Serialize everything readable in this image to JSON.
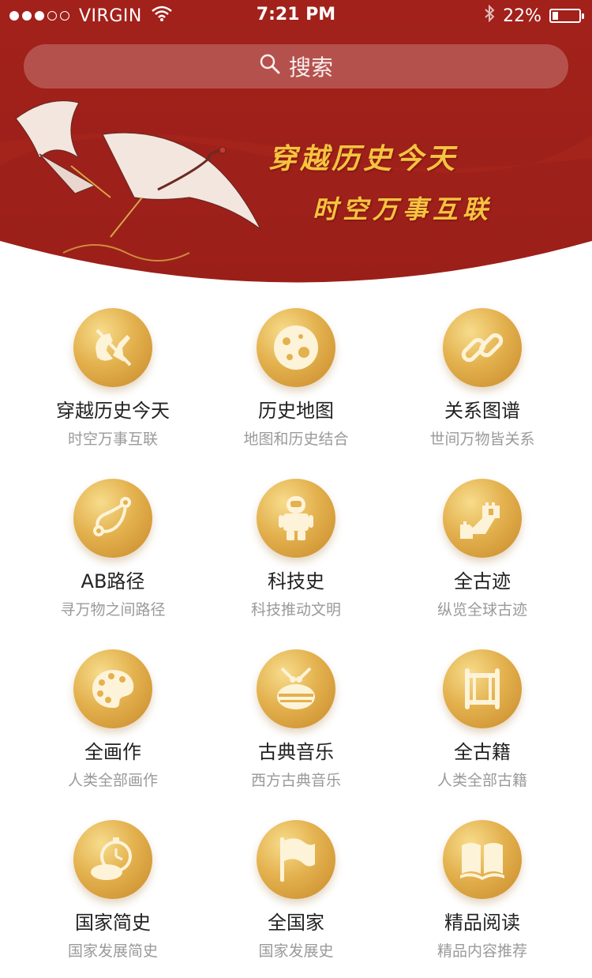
{
  "status_bar": {
    "carrier": "VIRGIN",
    "time": "7:21 PM",
    "battery": "22%",
    "battery_level": 0.22
  },
  "search": {
    "label": "搜索"
  },
  "banner": {
    "slogan_line1": "穿越历史今天",
    "slogan_line2": "时空万事互联"
  },
  "colors": {
    "banner_red": "#a7231c",
    "gold": "#e3b14e",
    "slogan_gold": "#f6c340"
  },
  "tiles": [
    {
      "title": "穿越历史今天",
      "subtitle": "时空万事互联",
      "icon": "time-travel-icon"
    },
    {
      "title": "历史地图",
      "subtitle": "地图和历史结合",
      "icon": "moon-map-icon"
    },
    {
      "title": "关系图谱",
      "subtitle": "世间万物皆关系",
      "icon": "link-icon"
    },
    {
      "title": "AB路径",
      "subtitle": "寻万物之间路径",
      "icon": "path-icon"
    },
    {
      "title": "科技史",
      "subtitle": "科技推动文明",
      "icon": "astronaut-icon"
    },
    {
      "title": "全古迹",
      "subtitle": "纵览全球古迹",
      "icon": "great-wall-icon"
    },
    {
      "title": "全画作",
      "subtitle": "人类全部画作",
      "icon": "palette-icon"
    },
    {
      "title": "古典音乐",
      "subtitle": "西方古典音乐",
      "icon": "drum-icon"
    },
    {
      "title": "全古籍",
      "subtitle": "人类全部古籍",
      "icon": "scroll-icon"
    },
    {
      "title": "国家简史",
      "subtitle": "国家发展简史",
      "icon": "stopwatch-icon"
    },
    {
      "title": "全国家",
      "subtitle": "国家发展史",
      "icon": "flag-icon"
    },
    {
      "title": "精品阅读",
      "subtitle": "精品内容推荐",
      "icon": "book-icon"
    }
  ]
}
